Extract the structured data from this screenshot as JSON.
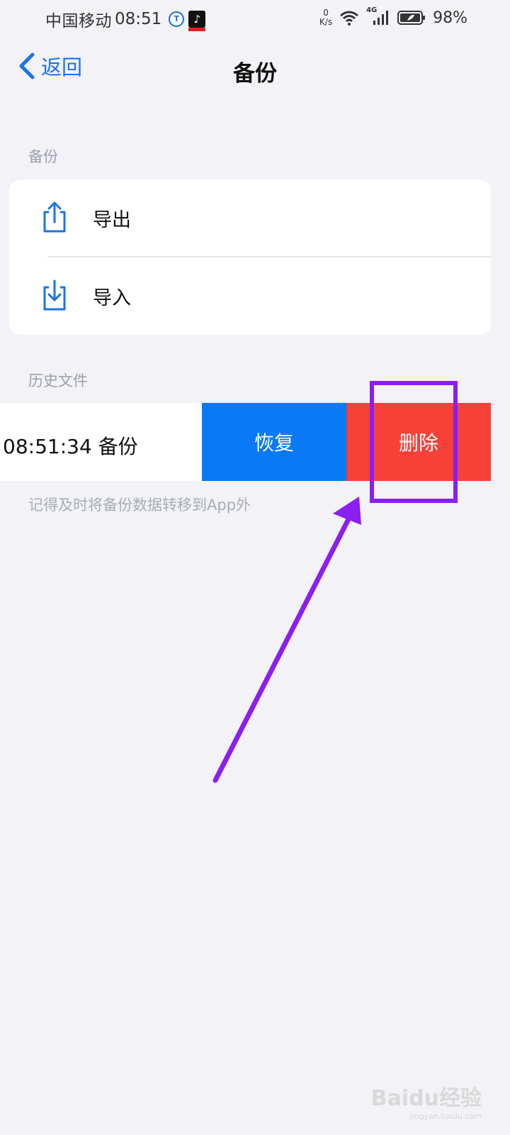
{
  "status_bar": {
    "carrier": "中国移动",
    "time": "08:51",
    "speed_value": "0",
    "speed_unit": "K/s",
    "network": "4G",
    "battery": "98%"
  },
  "nav": {
    "back_label": "返回",
    "title": "备份"
  },
  "backup_section": {
    "header": "备份",
    "items": [
      {
        "label": "导出",
        "icon": "share-export-icon"
      },
      {
        "label": "导入",
        "icon": "download-import-icon"
      }
    ]
  },
  "history_section": {
    "header": "历史文件",
    "row_text": "08:51:34 备份",
    "restore_label": "恢复",
    "delete_label": "删除",
    "hint": "记得及时将备份数据转移到App外"
  },
  "colors": {
    "accent": "#1a73e8",
    "restore_bg": "#0a79f5",
    "delete_bg": "#f64038",
    "annotation": "#8b1ef0"
  },
  "watermark": {
    "brand": "Baidu经验",
    "url": "jingyan.baidu.com"
  }
}
